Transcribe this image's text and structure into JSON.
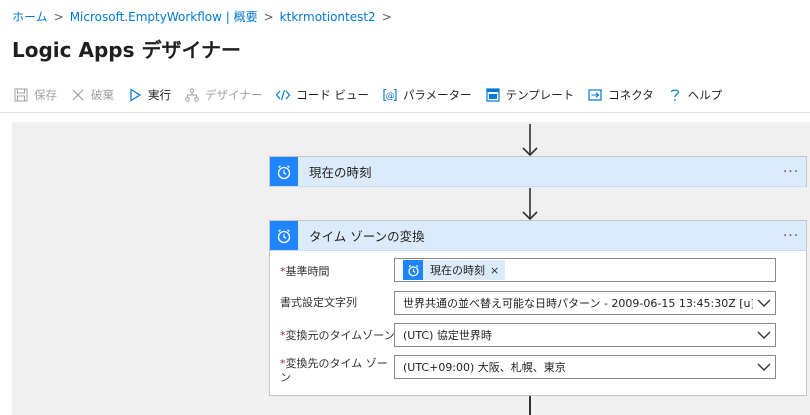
{
  "breadcrumb": {
    "items": [
      "ホーム",
      "Microsoft.EmptyWorkflow | 概要",
      "ktkrmotiontest2"
    ],
    "separator": ">"
  },
  "page_title": "Logic Apps デザイナー",
  "toolbar": {
    "save": "保存",
    "discard": "破棄",
    "run": "実行",
    "designer": "デザイナー",
    "code_view": "コード ビュー",
    "parameters": "パラメーター",
    "templates": "テンプレート",
    "connectors": "コネクタ",
    "help": "ヘルプ"
  },
  "steps": [
    {
      "title": "現在の時刻",
      "more": "···"
    },
    {
      "title": "タイム ゾーンの変換",
      "more": "···",
      "fields": {
        "base_time": {
          "label": "基準時間",
          "required": "*",
          "token": "現在の時刻",
          "remove": "×"
        },
        "format": {
          "label": "書式設定文字列",
          "value": "世界共通の並べ替え可能な日時パターン - 2009-06-15 13:45:30Z [u]"
        },
        "source_tz": {
          "label": "変換元のタイムゾーン",
          "required": "*",
          "value": "(UTC) 協定世界時"
        },
        "dest_tz": {
          "label": "変換先のタイム ゾーン",
          "required": "*",
          "value": "(UTC+09:00) 大阪、札幌、東京"
        }
      }
    }
  ],
  "colors": {
    "accent": "#0078d4",
    "card_header": "#dcebfb",
    "badge": "#1f85ff",
    "canvas": "#f0f0f0"
  }
}
